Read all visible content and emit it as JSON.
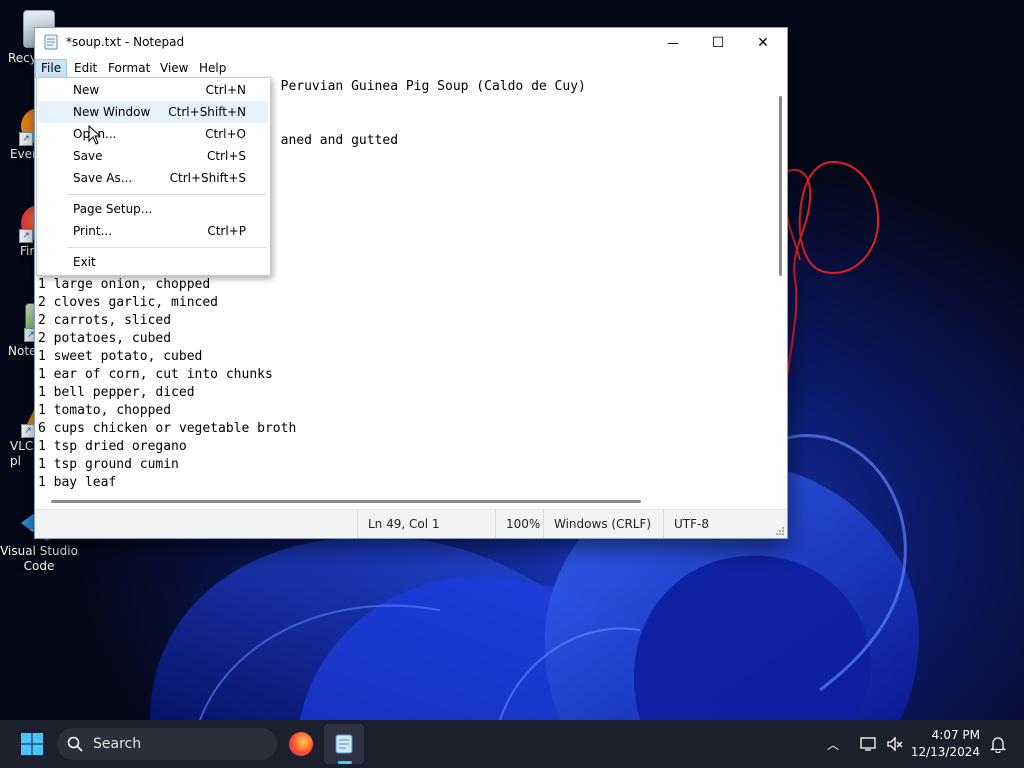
{
  "desktop": {
    "icons": [
      {
        "label": "Recy",
        "icon": "recycle-bin-icon"
      },
      {
        "label": "Ever",
        "icon": "everything-icon"
      },
      {
        "label": "Fir",
        "icon": "firefox-icon"
      },
      {
        "label": "Note",
        "icon": "notepad-icon"
      },
      {
        "label": "VLC\npl",
        "icon": "vlc-icon"
      },
      {
        "label": "Visual Studio\nCode",
        "icon": "vscode-icon"
      }
    ]
  },
  "window": {
    "title": "*soup.txt - Notepad",
    "minimize_glyph": "—",
    "maximize_glyph": "☐",
    "close_glyph": "✕"
  },
  "menubar": {
    "items": [
      "File",
      "Edit",
      "Format",
      "View",
      "Help"
    ]
  },
  "file_menu": {
    "items": [
      {
        "label": "New",
        "shortcut": "Ctrl+N"
      },
      {
        "label": "New Window",
        "shortcut": "Ctrl+Shift+N"
      },
      {
        "label": "Open...",
        "shortcut": "Ctrl+O"
      },
      {
        "label": "Save",
        "shortcut": "Ctrl+S"
      },
      {
        "label": "Save As...",
        "shortcut": "Ctrl+Shift+S"
      },
      {
        "label": "Page Setup...",
        "shortcut": ""
      },
      {
        "label": "Print...",
        "shortcut": "Ctrl+P"
      },
      {
        "label": "Exit",
        "shortcut": ""
      }
    ]
  },
  "editor": {
    "text": "                               Peruvian Guinea Pig Soup (Caldo de Cuy)\n\n\n                               aned and gutted\n\n\n\n\n\n\n\n1 large onion, chopped\n2 cloves garlic, minced\n2 carrots, sliced\n2 potatoes, cubed\n1 sweet potato, cubed\n1 ear of corn, cut into chunks\n1 bell pepper, diced\n1 tomato, chopped\n6 cups chicken or vegetable broth\n1 tsp dried oregano\n1 tsp ground cumin\n1 bay leaf"
  },
  "statusbar": {
    "position": "Ln 49, Col 1",
    "zoom": "100%",
    "line_ending": "Windows (CRLF)",
    "encoding": "UTF-8"
  },
  "taskbar": {
    "search_label": "Search",
    "time": "4:07 PM",
    "date": "12/13/2024"
  }
}
